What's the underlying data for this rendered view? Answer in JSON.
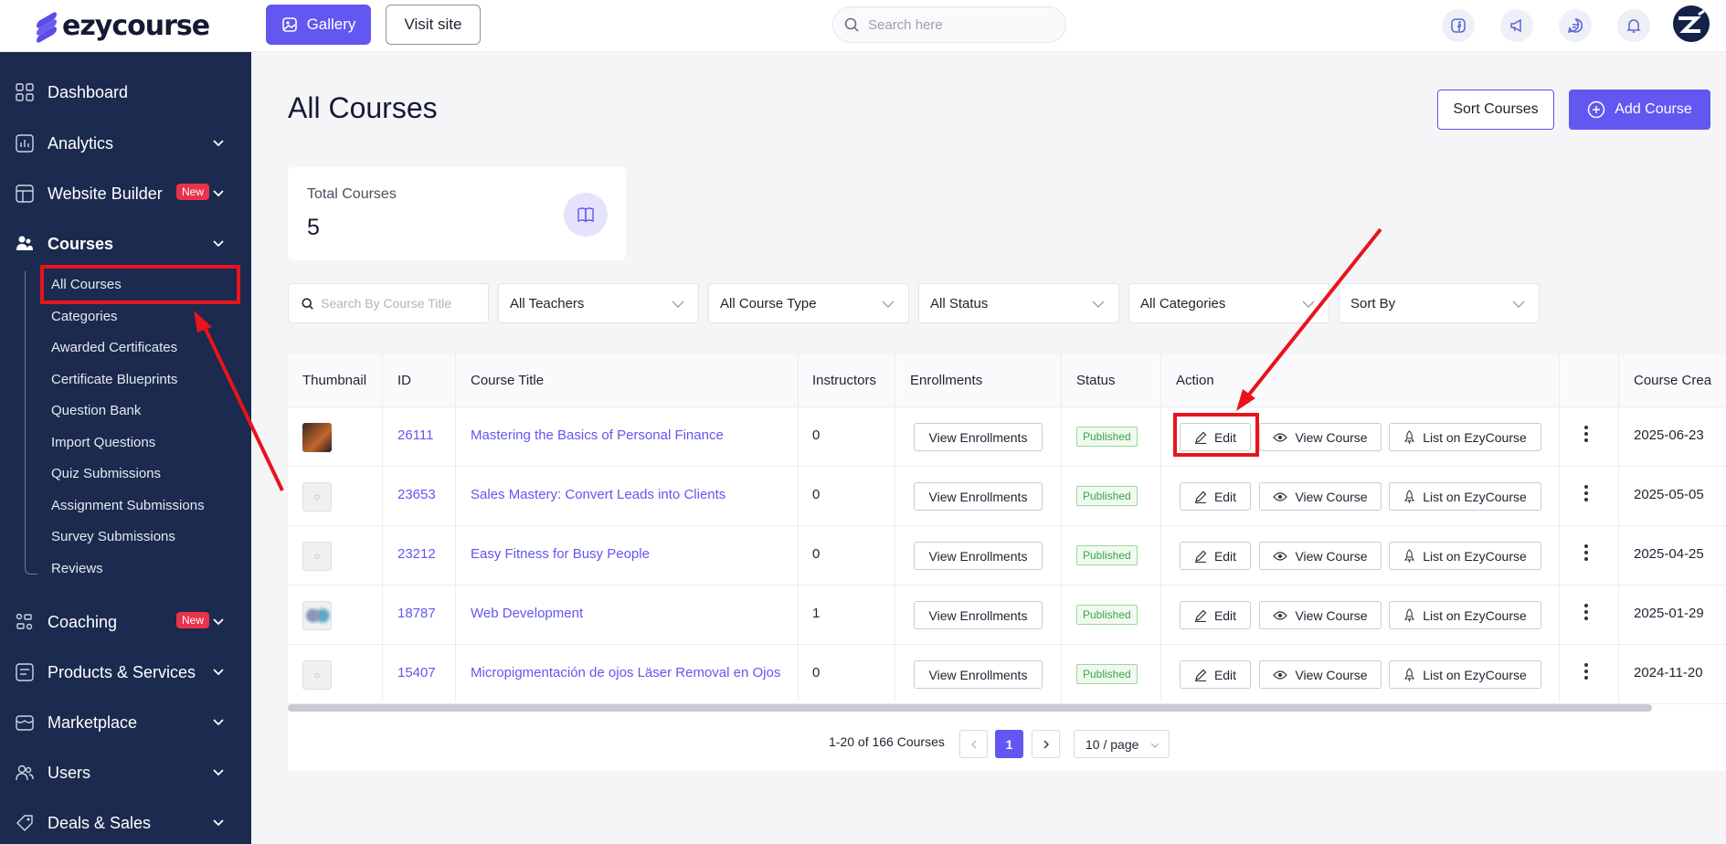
{
  "topbar": {
    "logo_text": "ezycourse",
    "gallery_label": "Gallery",
    "visit_site_label": "Visit site",
    "search_placeholder": "Search here",
    "icons": [
      "facebook-icon",
      "megaphone-icon",
      "chat-icon",
      "bell-icon"
    ]
  },
  "sidebar": {
    "items": [
      {
        "label": "Dashboard",
        "icon": "grid-icon"
      },
      {
        "label": "Analytics",
        "icon": "chart-icon"
      },
      {
        "label": "Website Builder",
        "icon": "layout-icon",
        "badge": "New"
      },
      {
        "label": "Courses",
        "icon": "users-icon"
      },
      {
        "label": "Coaching",
        "icon": "coaching-icon",
        "badge": "New"
      },
      {
        "label": "Products & Services",
        "icon": "box-icon"
      },
      {
        "label": "Marketplace",
        "icon": "store-icon"
      },
      {
        "label": "Users",
        "icon": "people-icon"
      },
      {
        "label": "Deals & Sales",
        "icon": "tag-icon"
      }
    ],
    "courses_sub": [
      "All Courses",
      "Categories",
      "Awarded Certificates",
      "Certificate Blueprints",
      "Question Bank",
      "Import Questions",
      "Quiz Submissions",
      "Assignment Submissions",
      "Survey Submissions",
      "Reviews"
    ]
  },
  "main": {
    "title": "All Courses",
    "sort_label": "Sort Courses",
    "add_label": "Add Course",
    "stat": {
      "label": "Total Courses",
      "value": "5"
    },
    "search_placeholder": "Search By Course Title",
    "filters": [
      "All Teachers",
      "All Course Type",
      "All Status",
      "All Categories",
      "Sort By"
    ]
  },
  "table": {
    "columns": [
      "Thumbnail",
      "ID",
      "Course Title",
      "Instructors",
      "Enrollments",
      "Status",
      "Action",
      "",
      "Course Crea"
    ],
    "enroll_label": "View Enrollments",
    "edit_label": "Edit",
    "view_label": "View Course",
    "list_label": "List on EzyCourse",
    "rows": [
      {
        "id": "26111",
        "title": "Mastering the Basics of Personal Finance",
        "instructors": "0",
        "status": "Published",
        "created": "2025-06-23"
      },
      {
        "id": "23653",
        "title": "Sales Mastery: Convert Leads into Clients",
        "instructors": "0",
        "status": "Published",
        "created": "2025-05-05"
      },
      {
        "id": "23212",
        "title": "Easy Fitness for Busy People",
        "instructors": "0",
        "status": "Published",
        "created": "2025-04-25"
      },
      {
        "id": "18787",
        "title": "Web Development",
        "instructors": "1",
        "status": "Published",
        "created": "2025-01-29"
      },
      {
        "id": "15407",
        "title": "Micropigmentación de ojos Läser Removal en Ojos",
        "instructors": "0",
        "status": "Published",
        "created": "2024-11-20"
      }
    ]
  },
  "pagination": {
    "summary": "1-20 of 166 Courses",
    "current_page": "1",
    "page_size": "10 / page"
  },
  "colors": {
    "accent": "#6257f0",
    "sidebar": "#1b2a4e",
    "annotation": "#e8141c"
  }
}
